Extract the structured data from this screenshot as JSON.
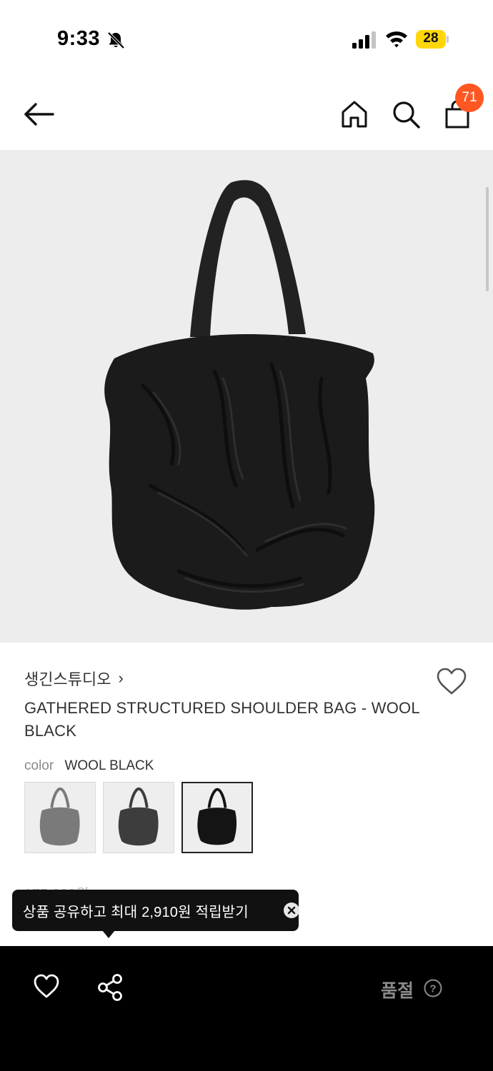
{
  "status_bar": {
    "time": "9:33",
    "battery_level": "28",
    "icons": [
      "bell-slash-icon",
      "signal-icon",
      "wifi-icon",
      "battery-icon"
    ]
  },
  "header": {
    "icons": [
      "back-arrow-icon",
      "home-icon",
      "search-icon",
      "shopping-bag-icon"
    ],
    "cart_count": "71",
    "badge_color": "#ff5722"
  },
  "product": {
    "brand": "생긴스튜디오",
    "brand_chevron": "›",
    "title": "GATHERED STRUCTURED SHOULDER BAG - WOOL BLACK",
    "color_label": "color",
    "color_value": "WOOL BLACK",
    "swatches": [
      {
        "name": "gray",
        "tone": "#7a7a7a",
        "selected": false
      },
      {
        "name": "charcoal",
        "tone": "#3d3d3d",
        "selected": false
      },
      {
        "name": "black",
        "tone": "#141414",
        "selected": true
      }
    ],
    "price_partial": "175,000원"
  },
  "tooltip": {
    "text": "상품 공유하고 최대 2,910원 적립받기"
  },
  "bottom_bar": {
    "status_label": "품절",
    "help_symbol": "?"
  }
}
